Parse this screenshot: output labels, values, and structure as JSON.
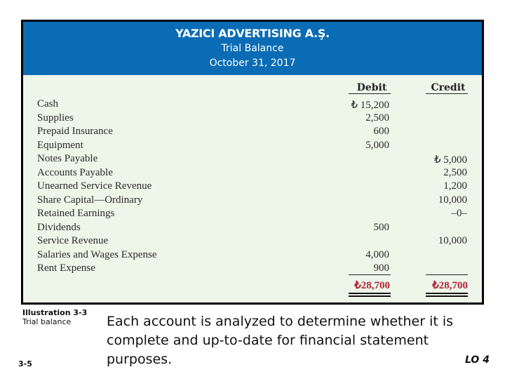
{
  "header": {
    "company": "YAZICI ADVERTISING A.Ş.",
    "title": "Trial Balance",
    "date": "October 31, 2017",
    "background_color": "#0a6cb5"
  },
  "columns": {
    "debit": "Debit",
    "credit": "Credit"
  },
  "accounts": [
    {
      "name": "Cash",
      "debit": "₺ 15,200",
      "credit": ""
    },
    {
      "name": "Supplies",
      "debit": "2,500",
      "credit": ""
    },
    {
      "name": "Prepaid Insurance",
      "debit": "600",
      "credit": ""
    },
    {
      "name": "Equipment",
      "debit": "5,000",
      "credit": ""
    },
    {
      "name": "Notes Payable",
      "debit": "",
      "credit": "₺  5,000"
    },
    {
      "name": "Accounts Payable",
      "debit": "",
      "credit": "2,500"
    },
    {
      "name": "Unearned Service Revenue",
      "debit": "",
      "credit": "1,200"
    },
    {
      "name": "Share Capital—Ordinary",
      "debit": "",
      "credit": "10,000"
    },
    {
      "name": "Retained Earnings",
      "debit": "",
      "credit": "–0–"
    },
    {
      "name": "Dividends",
      "debit": "500",
      "credit": ""
    },
    {
      "name": "Service Revenue",
      "debit": "",
      "credit": "10,000"
    },
    {
      "name": "Salaries and Wages Expense",
      "debit": "4,000",
      "credit": ""
    },
    {
      "name": "Rent Expense",
      "debit": "900",
      "credit": ""
    }
  ],
  "totals": {
    "debit": "₺28,700",
    "credit": "₺28,700",
    "color": "#b0233a"
  },
  "illustration": {
    "number": "Illustration 3-3",
    "caption": "Trial balance"
  },
  "slide_number": "3-5",
  "body_text": "Each account is analyzed to determine whether it is complete and up-to-date for financial statement purposes.",
  "learning_objective": "LO 4"
}
